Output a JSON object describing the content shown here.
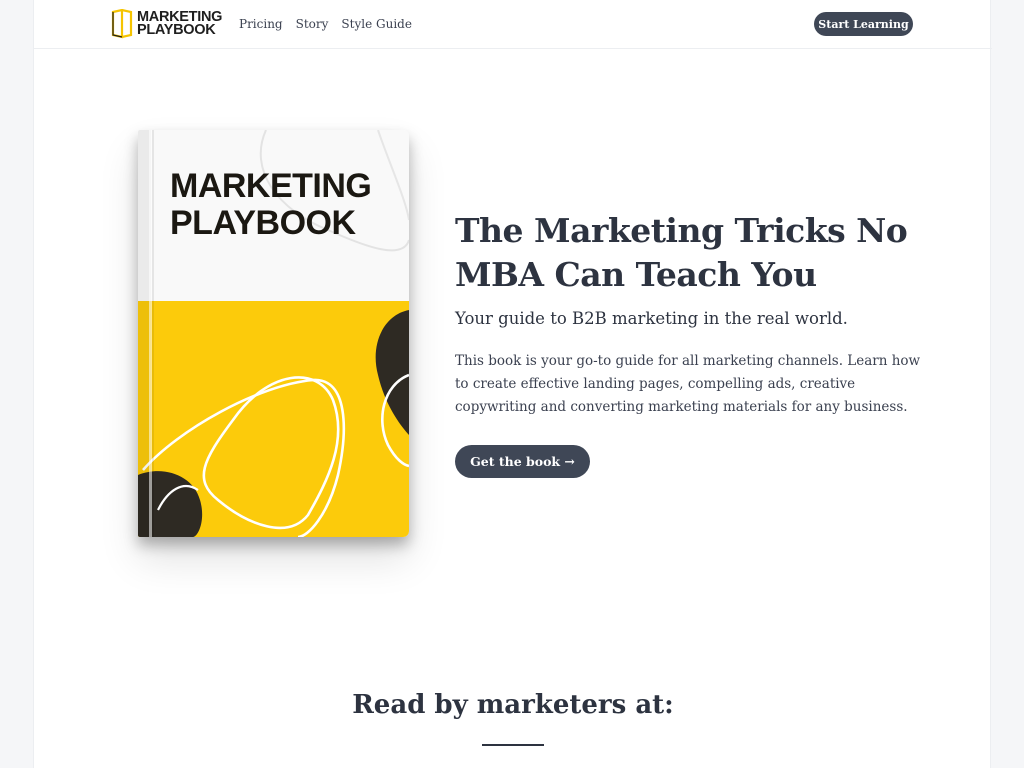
{
  "header": {
    "logo_line1": "MARKETING",
    "logo_line2": "PLAYBOOK",
    "nav": [
      "Pricing",
      "Story",
      "Style Guide"
    ],
    "cta_label": "Start Learning"
  },
  "book": {
    "title_line1": "MARKETING",
    "title_line2": "PLAYBOOK",
    "colors": {
      "top": "#f9f9f9",
      "bottom": "#fccb0b",
      "blob": "#2e2a23",
      "spine": "#e9e9e9"
    }
  },
  "hero": {
    "title": "The Marketing Tricks No MBA Can Teach You",
    "subtitle": "Your guide to B2B marketing in the real world.",
    "body": "This book is your go-to guide for all marketing channels. Learn how to create effective landing pages, compelling ads, creative copywriting and converting marketing materials for any business.",
    "cta_label": "Get the book →"
  },
  "social_proof": {
    "heading": "Read by marketers at:"
  },
  "colors": {
    "accent": "#3f4756",
    "text": "#2d3340",
    "brand_yellow": "#fccb0b"
  }
}
